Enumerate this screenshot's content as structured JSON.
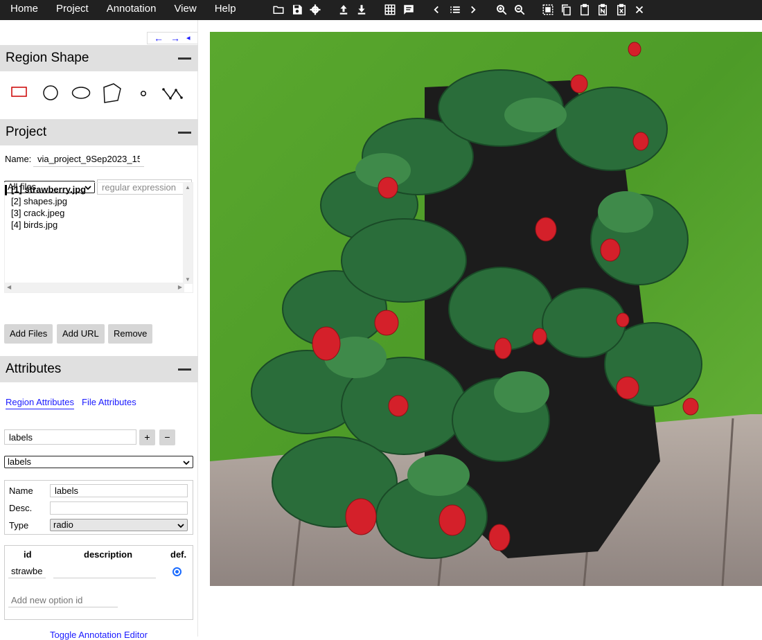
{
  "menu": {
    "items": [
      "Home",
      "Project",
      "Annotation",
      "View",
      "Help"
    ]
  },
  "toolbar_icons": [
    "folder-open-icon",
    "save-icon",
    "settings-icon",
    "upload-icon",
    "download-icon",
    "grid-icon",
    "comment-icon",
    "chevron-left-icon",
    "list-icon",
    "chevron-right-icon",
    "zoom-in-icon",
    "zoom-out-icon",
    "select-all-icon",
    "copy-icon",
    "paste-icon",
    "paste-n-icon",
    "delete-region-icon",
    "close-icon"
  ],
  "panel_nav": {
    "left": "←",
    "right": "→",
    "collapse": "◂"
  },
  "region_shape": {
    "title": "Region Shape",
    "shapes": [
      "rectangle-icon",
      "circle-icon",
      "ellipse-icon",
      "polygon-icon",
      "point-icon",
      "polyline-icon"
    ],
    "selected": "rectangle-icon",
    "selected_color": "#cc0000"
  },
  "project": {
    "title": "Project",
    "name_label": "Name:",
    "name_value": "via_project_9Sep2023_15",
    "filter_selected": "All files",
    "filter_placeholder": "regular expression",
    "files": [
      {
        "label": "[1] strawberry.jpg",
        "active": true
      },
      {
        "label": "[2] shapes.jpg",
        "active": false
      },
      {
        "label": "[3] crack.jpeg",
        "active": false
      },
      {
        "label": "[4] birds.jpg",
        "active": false
      }
    ],
    "buttons": {
      "add_files": "Add Files",
      "add_url": "Add URL",
      "remove": "Remove"
    }
  },
  "attributes": {
    "title": "Attributes",
    "tabs": {
      "region": "Region Attributes",
      "file": "File Attributes"
    },
    "new_attr_value": "labels",
    "add_label": "+",
    "remove_label": "−",
    "attr_select": "labels",
    "name_label": "Name",
    "name_value": "labels",
    "desc_label": "Desc.",
    "desc_value": "",
    "type_label": "Type",
    "type_value": "radio",
    "options_table": {
      "headers": {
        "id": "id",
        "description": "description",
        "default": "def."
      },
      "rows": [
        {
          "id": "strawbe",
          "description": "",
          "default": true
        }
      ],
      "new_option_placeholder": "Add new option id"
    },
    "toggle_editor": "Toggle Annotation Editor"
  }
}
